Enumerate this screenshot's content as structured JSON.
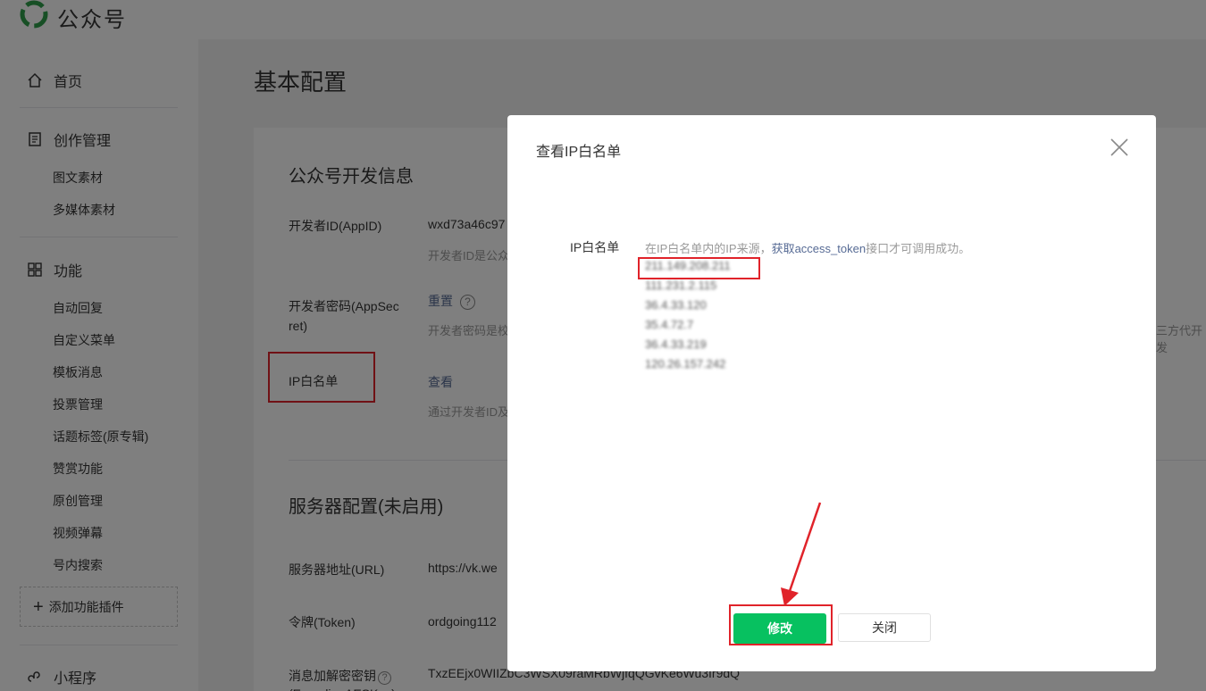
{
  "header": {
    "brand": "公众号"
  },
  "sidebar": {
    "home": "首页",
    "creation": {
      "title": "创作管理",
      "items": [
        "图文素材",
        "多媒体素材"
      ]
    },
    "features": {
      "title": "功能",
      "items": [
        "自动回复",
        "自定义菜单",
        "模板消息",
        "投票管理",
        "话题标签(原专辑)",
        "赞赏功能",
        "原创管理",
        "视频弹幕",
        "号内搜索"
      ]
    },
    "add_plugin": "添加功能插件",
    "miniprogram": "小程序"
  },
  "page": {
    "title": "基本配置",
    "dev_info": {
      "title": "公众号开发信息",
      "appid_label": "开发者ID(AppID)",
      "appid_value": "wxd73a46c97",
      "appid_desc": "开发者ID是公众",
      "secret_label_1": "开发者密码(AppSec",
      "secret_label_2": "ret)",
      "secret_link": "重置",
      "secret_help": "?",
      "secret_desc": "开发者密码是校",
      "secret_desc_tail": "三方代开发",
      "ip_label": "IP白名单",
      "ip_link": "查看",
      "ip_desc": "通过开发者ID及"
    },
    "server_config": {
      "title": "服务器配置(未启用)",
      "url_label": "服务器地址(URL)",
      "url_value": "https://vk.we",
      "token_label": "令牌(Token)",
      "token_value": "ordgoing112",
      "aes_label": "消息加解密密钥",
      "aes_label_2": "(EncodingAESKey)",
      "aes_value": "TxzEEjx0WIIZbC3WSX09raMRbWjfqQGvKe6Wu3Ir9dQ"
    }
  },
  "dialog": {
    "title": "查看IP白名单",
    "ip_label": "IP白名单",
    "tip_prefix": "在IP白名单内的IP来源，",
    "tip_link": "获取access_token",
    "tip_suffix": "接口才可调用成功。",
    "ips": [
      "211.149.208.211",
      "111.231.2.115",
      "36.4.33.120",
      "35.4.72.7",
      "36.4.33.219",
      "120.26.157.242"
    ],
    "modify_button": "修改",
    "close_button": "关闭"
  },
  "colors": {
    "accent_green": "#07c160",
    "link_blue": "#576b95",
    "highlight_red": "#e0232a"
  }
}
